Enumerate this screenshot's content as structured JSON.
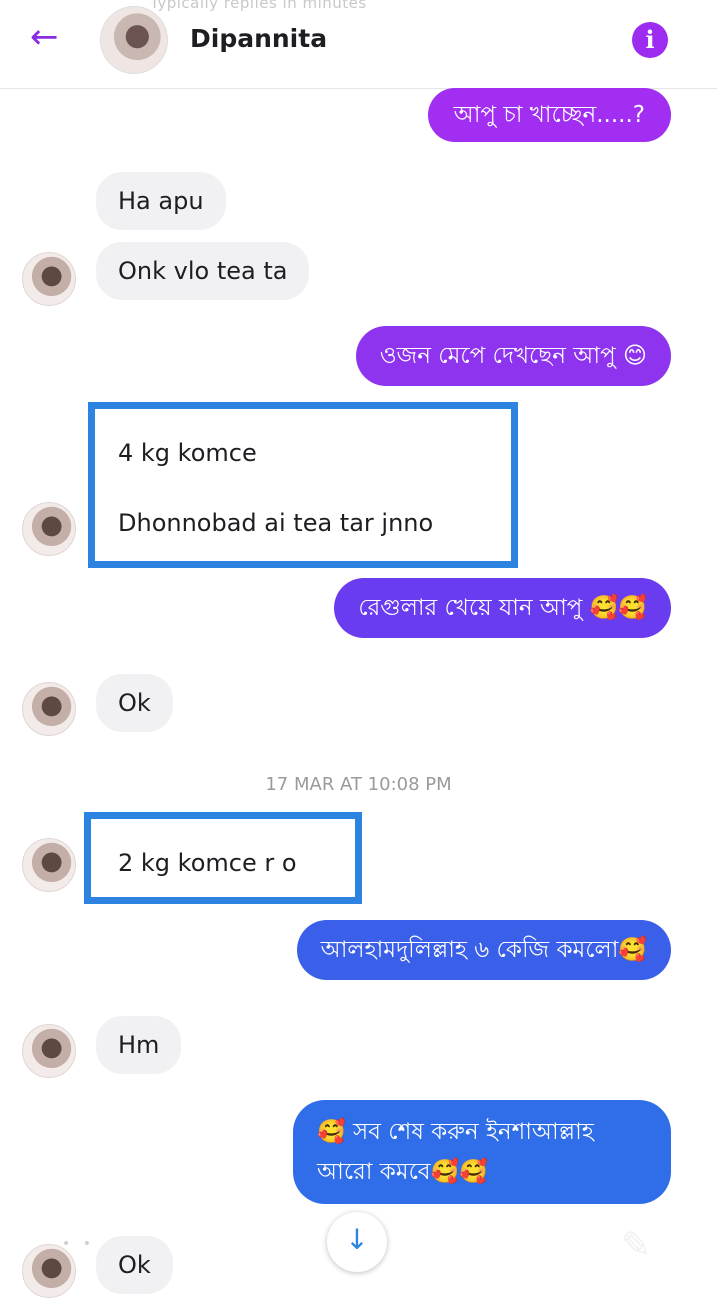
{
  "header": {
    "subline": "Typically replies in minutes",
    "title": "Dipannita",
    "back_icon": "←",
    "info_icon": "i"
  },
  "messages": [
    {
      "side": "out",
      "text": "আপু চা খাচ্ছেন.....?"
    },
    {
      "side": "in",
      "text": "Ha apu"
    },
    {
      "side": "in",
      "text": "Onk vlo tea ta"
    },
    {
      "side": "out",
      "text": "ওজন মেপে দেখছেন আপু 😊"
    },
    {
      "side": "in",
      "text": "4 kg komce"
    },
    {
      "side": "in",
      "text": "Dhonnobad ai tea tar jnno"
    },
    {
      "side": "out",
      "text": "রেগুলার খেয়ে যান আপু 🥰🥰"
    },
    {
      "side": "in",
      "text": "Ok"
    },
    {
      "side": "in",
      "text": "2 kg komce r o"
    },
    {
      "side": "out",
      "text": "আলহামদুলিল্লাহ ৬ কেজি কমলো🥰"
    },
    {
      "side": "in",
      "text": "Hm"
    },
    {
      "side": "out",
      "text": "🥰 সব শেষ করুন ইনশাআল্লাহ"
    },
    {
      "side": "out",
      "text": "আরো কমবে🥰🥰"
    },
    {
      "side": "in",
      "text": "Ok"
    }
  ],
  "timestamp": "17 MAR AT 10:08 PM",
  "scroll_icon": "↓",
  "compose_icon": "✎",
  "colors": {
    "purple": "#9b2cf0",
    "violet": "#6a3cf0",
    "blue": "#2f6ee8",
    "highlight": "#2d84e0"
  }
}
